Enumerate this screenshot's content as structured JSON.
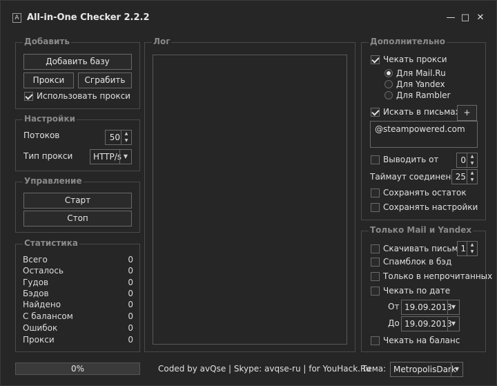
{
  "window": {
    "title": "All-in-One Checker 2.2.2",
    "icon": "app-icon",
    "icon_glyph": "A",
    "minimize": "—",
    "maximize": "□",
    "close": "✕"
  },
  "add_group": {
    "label": "Добавить",
    "add_base": "Добавить базу",
    "proxy": "Прокси",
    "grab": "Сграбить",
    "use_proxy": "Использовать прокси",
    "use_proxy_checked": true
  },
  "settings": {
    "label": "Настройки",
    "threads_label": "Потоков",
    "threads_value": "50",
    "proxy_type_label": "Тип прокси",
    "proxy_type_value": "HTTP/s"
  },
  "control": {
    "label": "Управление",
    "start": "Старт",
    "stop": "Стоп"
  },
  "stats": {
    "label": "Статистика",
    "rows": [
      {
        "k": "Всего",
        "v": "0"
      },
      {
        "k": "Осталось",
        "v": "0"
      },
      {
        "k": "Гудов",
        "v": "0"
      },
      {
        "k": "Бэдов",
        "v": "0"
      },
      {
        "k": "Найдено",
        "v": "0"
      },
      {
        "k": "С балансом",
        "v": "0"
      },
      {
        "k": "Ошибок",
        "v": "0"
      },
      {
        "k": "Прокси",
        "v": "0"
      }
    ]
  },
  "log": {
    "label": "Лог"
  },
  "extra": {
    "label": "Дополнительно",
    "check_proxy": "Чекать прокси",
    "check_proxy_checked": true,
    "radios": [
      {
        "label": "Для Mail.Ru",
        "checked": true
      },
      {
        "label": "Для Yandex",
        "checked": false
      },
      {
        "label": "Для Rambler",
        "checked": false
      }
    ],
    "search_in_mail": "Искать в письмах",
    "search_in_mail_checked": true,
    "plus": "+",
    "search_value": "@steampowered.com",
    "output_from": "Выводить от",
    "output_from_value": "0",
    "timeout_label": "Таймаут соединения",
    "timeout_value": "25",
    "save_rest": "Сохранять остаток",
    "save_settings": "Сохранять настройки"
  },
  "mail_yandex": {
    "label": "Только Mail и Yandex",
    "download_letters": "Скачивать письма",
    "download_value": "1",
    "spamblock": "Спамблок в бэд",
    "unread_only": "Только в непрочитанных",
    "check_by_date": "Чекать по дате",
    "from_label": "От",
    "from_value": "19.09.2013",
    "to_label": "До",
    "to_value": "19.09.2013",
    "check_balance": "Чекать на баланс"
  },
  "footer": {
    "progress_text": "0%",
    "progress_value": 0,
    "credits": "Coded by avQse | Skype: avqse-ru | for YouHack.Ru",
    "theme_label": "Тема:",
    "theme_value": "MetropolisDark"
  },
  "colors": {
    "background": "#262626",
    "border": "#4a4a4a",
    "accent": "#5a8fc8",
    "text": "#e0e0e0",
    "group_label": "#8a8a8a"
  }
}
